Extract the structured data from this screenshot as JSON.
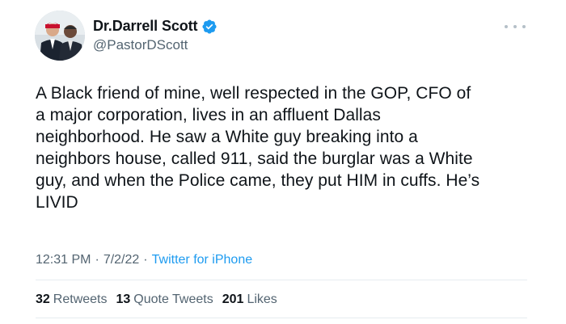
{
  "author": {
    "display_name": "Dr.Darrell Scott",
    "handle": "@PastorDScott",
    "verified": true,
    "avatar_icon": "profile-photo"
  },
  "tweet": {
    "text": "A Black friend of mine, well respected in the GOP, CFO of\na major corporation, lives in an affluent Dallas\nneighborhood. He saw a White guy breaking into a\nneighbors house, called 911, said the burglar was a White\nguy, and when the Police came, they put HIM in cuffs. He’s\nLIVID"
  },
  "meta": {
    "time": "12:31 PM",
    "separator1": "·",
    "date": "7/2/22",
    "separator2": "·",
    "source": "Twitter for iPhone"
  },
  "stats": {
    "retweets_count": "32",
    "retweets_label": "Retweets",
    "quote_count": "13",
    "quote_label": "Quote Tweets",
    "likes_count": "201",
    "likes_label": "Likes"
  },
  "colors": {
    "text": "#0f1419",
    "secondary": "#536471",
    "accent": "#1d9bf0"
  },
  "icons": {
    "verified": "verified-badge-icon",
    "more": "more-options-icon"
  }
}
